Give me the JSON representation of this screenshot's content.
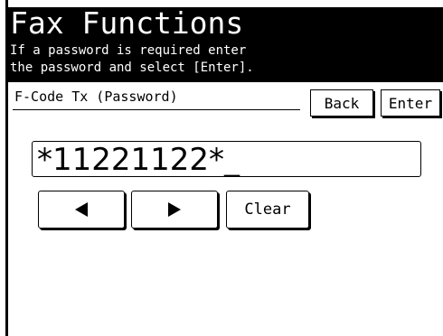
{
  "header": {
    "title": "Fax Functions",
    "instruction": "If a password is required enter\nthe password and select [Enter]."
  },
  "subheader": {
    "label": "F-Code Tx (Password)"
  },
  "buttons": {
    "back_label": "Back",
    "enter_label": "Enter",
    "clear_label": "Clear",
    "cursor_left_icon": "left-triangle-arrow",
    "cursor_right_icon": "right-triangle-arrow"
  },
  "input": {
    "value": "*11221122*_"
  },
  "colors": {
    "background": "#ffffff",
    "header_background": "#000000",
    "header_text": "#ffffff"
  }
}
